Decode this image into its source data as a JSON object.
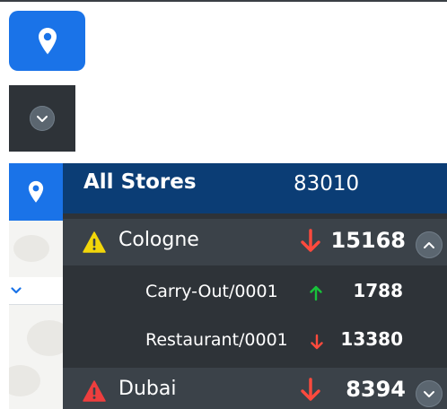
{
  "icons": {
    "location": "location-pin-icon",
    "expand": "chevron-down-icon",
    "collapse": "chevron-up-icon",
    "warning": "warning-triangle-icon",
    "trend_down": "arrow-down-icon",
    "trend_up": "arrow-up-icon"
  },
  "colors": {
    "brand_blue": "#1a73e8",
    "header_navy": "#0b3d75",
    "panel_bg": "#2e3338",
    "row_bg": "#3b4249",
    "warning_yellow": "#f2d60a",
    "alert_red": "#ee3e3e",
    "trend_up_green": "#18c23a",
    "trend_down_red": "#ff4a3d"
  },
  "panel": {
    "title": "All Stores",
    "total": "83010",
    "stores": [
      {
        "name": "Cologne",
        "value": "15168",
        "status": "warning",
        "trend": "down",
        "expanded": true,
        "children": [
          {
            "name": "Carry-Out/0001",
            "value": "1788",
            "trend": "up"
          },
          {
            "name": "Restaurant/0001",
            "value": "13380",
            "trend": "down"
          }
        ]
      },
      {
        "name": "Dubai",
        "value": "8394",
        "status": "alert",
        "trend": "down",
        "expanded": false
      }
    ]
  }
}
